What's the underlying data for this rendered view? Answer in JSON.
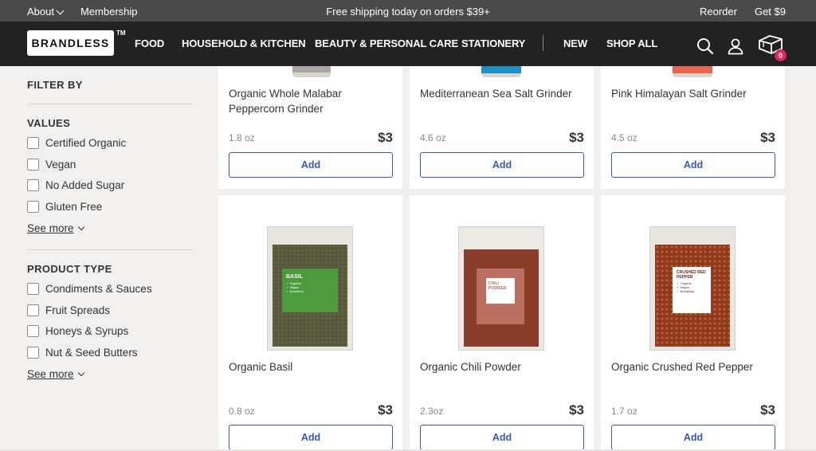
{
  "promo": {
    "about": "About",
    "membership": "Membership",
    "center": "Free shipping today on orders $39+",
    "reorder": "Reorder",
    "get": "Get $9"
  },
  "nav": {
    "logo": "BRANDLESS",
    "tm": "TM",
    "links": [
      "FOOD",
      "HOUSEHOLD & KITCHEN",
      "BEAUTY & PERSONAL CARE",
      "STATIONERY",
      "NEW",
      "SHOP ALL"
    ],
    "cart_count": "0"
  },
  "sidebar": {
    "title": "FILTER BY",
    "values": {
      "title": "VALUES",
      "items": [
        "Certified Organic",
        "Vegan",
        "No Added Sugar",
        "Gluten Free"
      ],
      "see_more": "See more"
    },
    "product_type": {
      "title": "PRODUCT TYPE",
      "items": [
        "Condiments & Sauces",
        "Fruit Spreads",
        "Honeys & Syrups",
        "Nut & Seed Butters"
      ],
      "see_more": "See more"
    }
  },
  "products": [
    {
      "name": "Organic Whole Malabar Peppercorn Grinder",
      "size": "1.8 oz",
      "price": "$3",
      "add": "Add",
      "cap_color": "#8a8a8a"
    },
    {
      "name": "Mediterranean Sea Salt Grinder",
      "size": "4.6 oz",
      "price": "$3",
      "add": "Add",
      "cap_color": "#1e8fc4"
    },
    {
      "name": "Pink Himalayan Salt Grinder",
      "size": "4.5 oz",
      "price": "$3",
      "add": "Add",
      "cap_color": "#e8654f"
    },
    {
      "name": "Organic Basil",
      "size": "0.8 oz",
      "price": "$3",
      "add": "Add",
      "label": "BASIL",
      "label_lines": [
        "✓ Organic",
        "✓ Vegan",
        "✓ Brandless"
      ],
      "label_color": "#4c9a3b",
      "fill_color": "#5b5b3d"
    },
    {
      "name": "Organic Chili Powder",
      "size": "2.3oz",
      "price": "$3",
      "add": "Add",
      "label": "CHILI POWDER",
      "label_lines": [
        "✓ Organic",
        "✓ Brandless"
      ],
      "label_color": "#b97060",
      "fill_color": "#8a3d2a"
    },
    {
      "name": "Organic Crushed Red Pepper",
      "size": "1.7 oz",
      "price": "$3",
      "add": "Add",
      "label": "CRUSHED RED PEPPER",
      "label_lines": [
        "✓ Organic",
        "✓ Vegan",
        "✓ Brandless"
      ],
      "label_color": "#ffffff",
      "fill_color": "#8f3a1f"
    }
  ]
}
